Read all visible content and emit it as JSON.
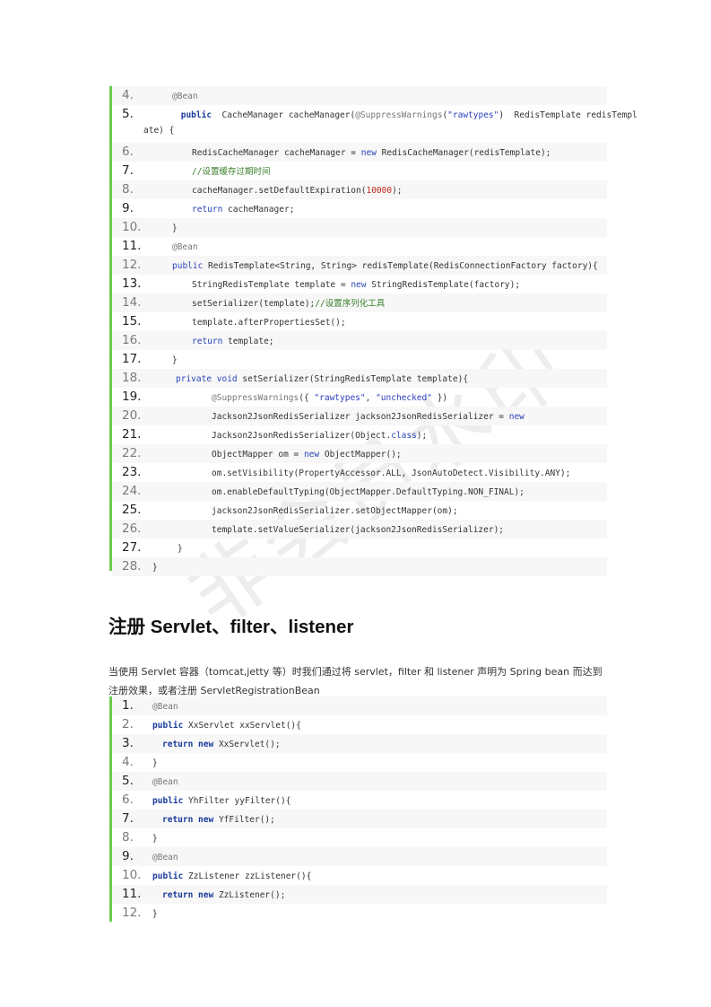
{
  "watermark": "非会员水印",
  "heading": "注册 Servlet、filter、listener",
  "paragraph": "当使用 Servlet 容器（tomcat,jetty 等）时我们通过将 servlet，filter 和 listener 声明为 Spring bean 而达到注册效果，或者注册 ServletRegistrationBean",
  "code_block_1": [
    {
      "num": "4.",
      "segments": [
        [
          "ann",
          "@Bean"
        ]
      ]
    },
    {
      "num": "5.",
      "segments": [
        [
          "kw",
          " public"
        ],
        [
          "",
          "  CacheManager cacheManager("
        ],
        [
          "ann",
          "@SuppressWarnings"
        ],
        [
          "",
          "("
        ],
        [
          "str",
          "\"rawtypes\""
        ],
        [
          "",
          ")  RedisTemplate redisTempl"
        ]
      ],
      "cont": "ate) {"
    },
    {
      "num": "6.",
      "segments": [
        [
          "",
          "RedisCacheManager cacheManager = "
        ],
        [
          "kw2",
          "new"
        ],
        [
          "",
          " RedisCacheManager(redisTemplate);"
        ]
      ]
    },
    {
      "num": "7.",
      "segments": [
        [
          "cm",
          "//设置缓存过期时间"
        ]
      ]
    },
    {
      "num": "8.",
      "segments": [
        [
          "",
          "cacheManager.setDefaultExpiration("
        ],
        [
          "num",
          "10000"
        ],
        [
          "",
          ");"
        ]
      ]
    },
    {
      "num": "9.",
      "segments": [
        [
          "kw2",
          "return"
        ],
        [
          "",
          " cacheManager;"
        ]
      ]
    },
    {
      "num": "10.",
      "segments": [
        [
          "",
          "}"
        ]
      ]
    },
    {
      "num": "11.",
      "segments": [
        [
          "ann",
          "@Bean"
        ]
      ]
    },
    {
      "num": "12.",
      "segments": [
        [
          "kw2",
          "public"
        ],
        [
          "",
          " RedisTemplate<String, String> redisTemplate(RedisConnectionFactory factory){"
        ]
      ]
    },
    {
      "num": "13.",
      "segments": [
        [
          "",
          "StringRedisTemplate template = "
        ],
        [
          "kw2",
          "new"
        ],
        [
          "",
          " StringRedisTemplate(factory);"
        ]
      ]
    },
    {
      "num": "14.",
      "segments": [
        [
          "",
          "setSerializer(template);"
        ],
        [
          "cm",
          "//设置序列化工具"
        ]
      ]
    },
    {
      "num": "15.",
      "segments": [
        [
          "",
          "template.afterPropertiesSet();"
        ]
      ]
    },
    {
      "num": "16.",
      "segments": [
        [
          "kw2",
          "return"
        ],
        [
          "",
          " template;"
        ]
      ]
    },
    {
      "num": "17.",
      "segments": [
        [
          "",
          "}"
        ]
      ]
    },
    {
      "num": "18.",
      "segments": [
        [
          "kw2",
          "private"
        ],
        [
          "kw2",
          " void"
        ],
        [
          "",
          " setSerializer(StringRedisTemplate template){"
        ]
      ]
    },
    {
      "num": "19.",
      "segments": [
        [
          "ann",
          "@SuppressWarnings"
        ],
        [
          "",
          "({ "
        ],
        [
          "str",
          "\"rawtypes\""
        ],
        [
          "",
          ", "
        ],
        [
          "str",
          "\"unchecked\""
        ],
        [
          "",
          " })"
        ]
      ]
    },
    {
      "num": "20.",
      "segments": [
        [
          "",
          "Jackson2JsonRedisSerializer jackson2JsonRedisSerializer = "
        ],
        [
          "kw2",
          "new"
        ]
      ]
    },
    {
      "num": "21.",
      "segments": [
        [
          "",
          "Jackson2JsonRedisSerializer(Object."
        ],
        [
          "kw2",
          "class"
        ],
        [
          "",
          ");"
        ]
      ]
    },
    {
      "num": "22.",
      "segments": [
        [
          "",
          "ObjectMapper om = "
        ],
        [
          "kw2",
          "new"
        ],
        [
          "",
          " ObjectMapper();"
        ]
      ]
    },
    {
      "num": "23.",
      "segments": [
        [
          "",
          "om.setVisibility(PropertyAccessor.ALL, JsonAutoDetect.Visibility.ANY);"
        ]
      ]
    },
    {
      "num": "24.",
      "segments": [
        [
          "",
          "om.enableDefaultTyping(ObjectMapper.DefaultTyping.NON_FINAL);"
        ]
      ]
    },
    {
      "num": "25.",
      "segments": [
        [
          "",
          "jackson2JsonRedisSerializer.setObjectMapper(om);"
        ]
      ]
    },
    {
      "num": "26.",
      "segments": [
        [
          "",
          "template.setValueSerializer(jackson2JsonRedisSerializer);"
        ]
      ]
    },
    {
      "num": "27.",
      "segments": [
        [
          "",
          "}"
        ]
      ]
    },
    {
      "num": "28.",
      "segments": [
        [
          "",
          "}"
        ]
      ]
    }
  ],
  "code_block_2": [
    {
      "num": "1.",
      "segments": [
        [
          "ann",
          "@Bean"
        ]
      ]
    },
    {
      "num": "2.",
      "segments": [
        [
          "kw",
          "public"
        ],
        [
          "",
          " XxServlet xxServlet(){"
        ]
      ]
    },
    {
      "num": "3.",
      "segments": [
        [
          "kw",
          "return"
        ],
        [
          "kw",
          " new"
        ],
        [
          "",
          " XxServlet();"
        ]
      ]
    },
    {
      "num": "4.",
      "segments": [
        [
          "",
          "}"
        ]
      ]
    },
    {
      "num": "5.",
      "segments": [
        [
          "ann",
          "@Bean"
        ]
      ]
    },
    {
      "num": "6.",
      "segments": [
        [
          "kw",
          "public"
        ],
        [
          "",
          " YhFilter yyFilter(){"
        ]
      ]
    },
    {
      "num": "7.",
      "segments": [
        [
          "kw",
          "return"
        ],
        [
          "kw",
          " new"
        ],
        [
          "",
          " YfFilter();"
        ]
      ]
    },
    {
      "num": "8.",
      "segments": [
        [
          "",
          "}"
        ]
      ]
    },
    {
      "num": "9.",
      "segments": [
        [
          "ann",
          "@Bean"
        ]
      ]
    },
    {
      "num": "10.",
      "segments": [
        [
          "kw",
          "public"
        ],
        [
          "",
          " ZzListener zzListener(){"
        ]
      ]
    },
    {
      "num": "11.",
      "segments": [
        [
          "kw",
          "return"
        ],
        [
          "kw",
          " new"
        ],
        [
          "",
          " ZzListener();"
        ]
      ]
    },
    {
      "num": "12.",
      "segments": [
        [
          "",
          "}"
        ]
      ]
    }
  ]
}
